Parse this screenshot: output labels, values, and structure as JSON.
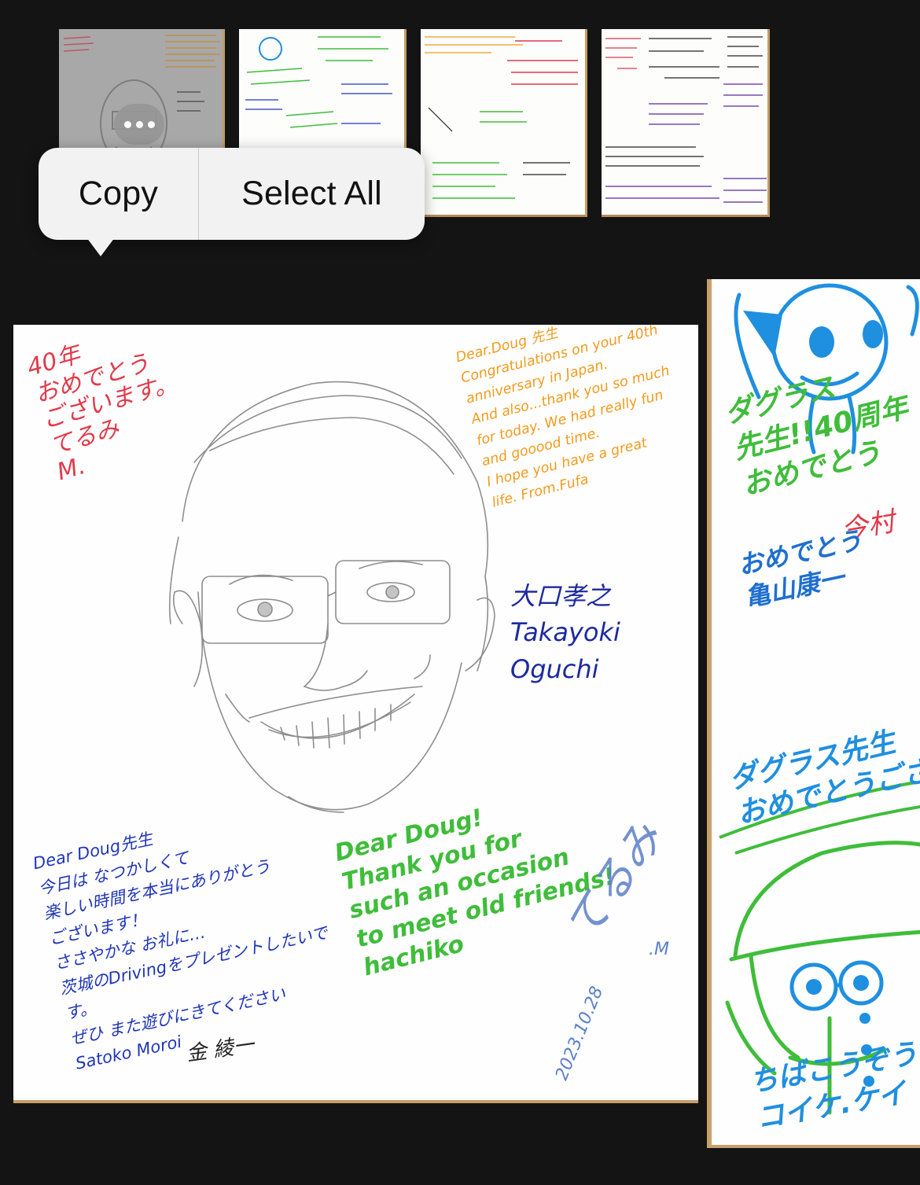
{
  "thumbnails": [
    {
      "name": "portrait-card",
      "selected": true
    },
    {
      "name": "character-card",
      "selected": false
    },
    {
      "name": "congratulations-card",
      "selected": false
    },
    {
      "name": "messages-card",
      "selected": false
    }
  ],
  "more_button": {
    "icon": "ellipsis-icon"
  },
  "context_menu": {
    "copy": "Copy",
    "select_all": "Select All"
  },
  "main_card": {
    "top_left": "40年\nおめでとう\nございます。\nてるみ\nM.",
    "top_right": "Dear.Doug 先生\nCongratulations on your 40th\nanniversary in Japan.\nAnd also...thank you so much\nfor today. We had really fun\nand gooood time.\nI hope you have a great\nlife.        From.Fufa",
    "signature": "大口孝之\nTakayoki\nOguchi",
    "bottom_left": "Dear Doug先生\n今日は なつかしくて\n楽しい時間を本当にありがとう\nございます！\nささやかな お礼に…\n茨城のDrivingをプレゼントしたいです。\nぜひ また遊びにきてください\nSatoko Moroi",
    "bottom_left_name": "金 綾一",
    "bottom_center": "Dear Doug!\nThank you for\nsuch an occasion\nto meet old friends!\nhachiko",
    "bottom_right_name": "てるみ",
    "bottom_right_mark": ".M",
    "date": "2023.10.28"
  },
  "side_card": {
    "top_text": "ダグラス\n先生!!40周年\nおめでとう",
    "name1": "今村",
    "message": "おめでとう\n亀山康一",
    "bottom_title": "ダグラス先生\nおめでとうございます",
    "bottom_text": "ちばこうぞうくん\nコイケ.ケイ"
  },
  "colors": {
    "background": "#141414",
    "menu": "#f2f2f2",
    "board_edge": "#c9a06b"
  }
}
